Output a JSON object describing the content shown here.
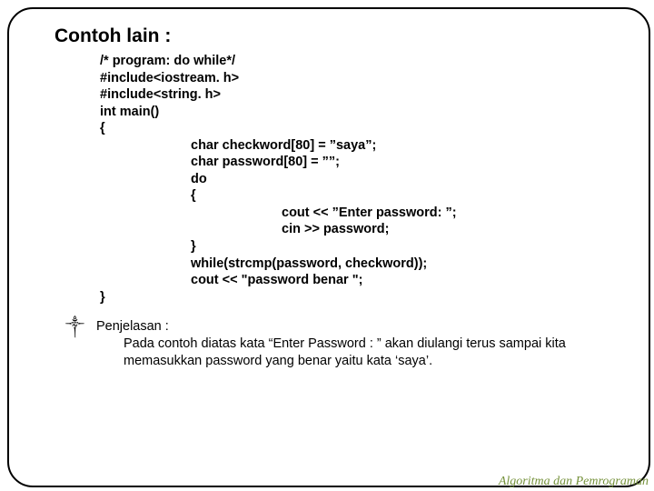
{
  "title": "Contoh lain :",
  "code": {
    "l1": "/* program: do while*/",
    "l2": "#include<iostream. h>",
    "l3": "#include<string. h>",
    "l4": "int main()",
    "l5": "{",
    "l6": "char checkword[80] = ”saya”;",
    "l7": "char password[80] = ””;",
    "l8": "do",
    "l9": "{",
    "l10": "cout << ”Enter password: ”;",
    "l11": "cin >> password;",
    "l12": "}",
    "l13": "while(strcmp(password, checkword));",
    "l14": "cout << \"password benar \";",
    "l15": "}"
  },
  "explain": {
    "head": "Penjelasan :",
    "para": "Pada contoh diatas kata “Enter Password : ” akan diulangi terus sampai kita memasukkan password yang benar yaitu kata ‘saya’."
  },
  "footer": "Algoritma dan Pemrograman",
  "bullet_glyph": "༒"
}
